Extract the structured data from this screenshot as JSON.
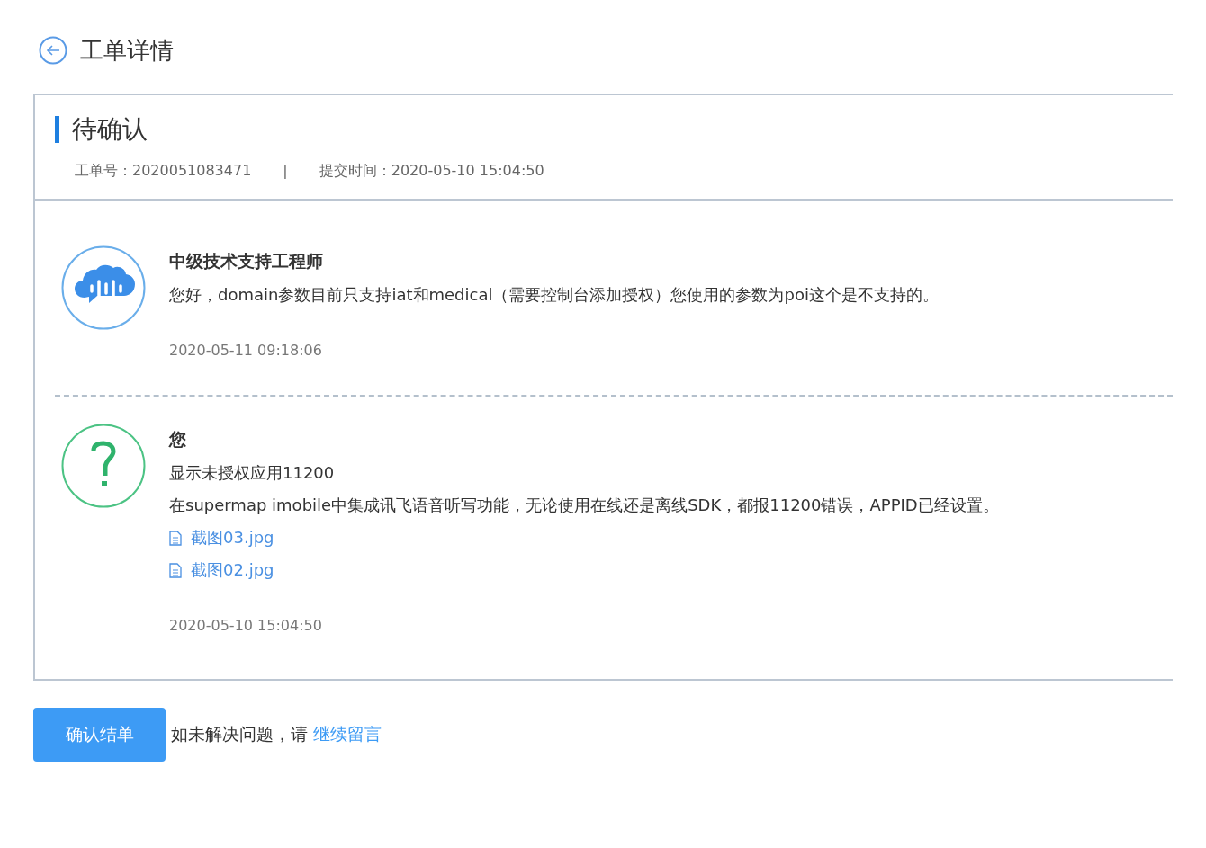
{
  "page_title": "工单详情",
  "ticket": {
    "status": "待确认",
    "number_label": "工单号：",
    "number": "2020051083471",
    "separator": "|",
    "submitted_label": "提交时间：",
    "submitted": "2020-05-10 15:04:50"
  },
  "messages": [
    {
      "kind": "staff",
      "author": "中级技术支持工程师",
      "lines": [
        "您好，domain参数目前只支持iat和medical（需要控制台添加授权）您使用的参数为poi这个是不支持的。"
      ],
      "time": "2020-05-11 09:18:06"
    },
    {
      "kind": "user",
      "author": "您",
      "lines": [
        "显示未授权应用11200",
        "在supermap imobile中集成讯飞语音听写功能，无论使用在线还是离线SDK，都报11200错误，APPID已经设置。"
      ],
      "attachments": [
        "截图03.jpg",
        "截图02.jpg"
      ],
      "time": "2020-05-10 15:04:50"
    }
  ],
  "footer": {
    "button": "确认结单",
    "prompt": "如未解决问题，请",
    "link": "继续留言"
  }
}
